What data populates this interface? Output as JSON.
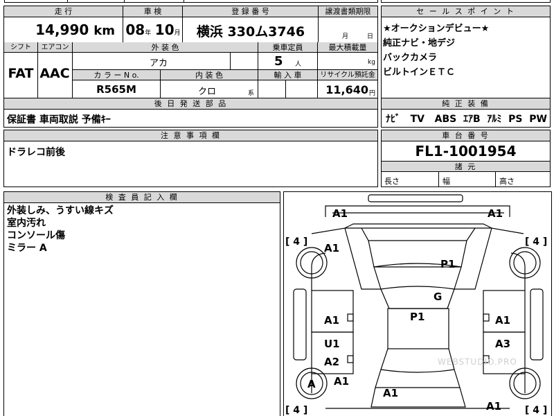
{
  "top_partial": {
    "text": ""
  },
  "main": {
    "mileage": {
      "label": "走 行",
      "value": "14,990",
      "unit": "km"
    },
    "inspection": {
      "label": "車 検",
      "year": "08",
      "year_unit": "年",
      "month": "10",
      "month_unit": "月"
    },
    "registration": {
      "label": "登 録 番 号",
      "value": "横浜 330ム3746"
    },
    "transfer_deadline": {
      "label": "譲渡書類期限",
      "month_unit": "月",
      "day_unit": "日"
    },
    "shift": {
      "label": "シフト",
      "value": "FAT"
    },
    "aircon": {
      "label": "エアコン",
      "value": "AAC"
    },
    "exterior_color": {
      "label": "外 装 色",
      "value": "アカ"
    },
    "color_no": {
      "label": "カ ラ ー N o.",
      "value": "R565M"
    },
    "interior_color": {
      "label": "内 装 色",
      "value": "クロ",
      "suffix": "系"
    },
    "capacity": {
      "label": "乗車定員",
      "value": "5",
      "unit": "人"
    },
    "max_load": {
      "label": "最大積載量",
      "unit": "kg"
    },
    "import": {
      "label": "輸 入 車"
    },
    "recycle": {
      "label": "リサイクル預託金",
      "value": "11,640",
      "unit": "円"
    }
  },
  "sales_points": {
    "label": "セ ー ル ス ポ イ ン ト",
    "lines": [
      "★オークションデビュー★",
      "純正ナビ・地デジ",
      "バックカメラ",
      "ビルトインＥＴＣ"
    ]
  },
  "parts": {
    "label": "後 日 発 送 部 品",
    "value": "保証書  車両取説  予備ｷｰ"
  },
  "equipment": {
    "label": "純 正 装 備",
    "items": [
      "ﾅﾋﾞ",
      "TV",
      "ABS",
      "ｴｱB",
      "ｱﾙﾐ",
      "PS",
      "PW"
    ]
  },
  "notes": {
    "label": "注 意 事 項 欄",
    "value": "ドラレコ前後"
  },
  "chassis": {
    "label": "車 台 番 号",
    "value": "FL1-1001954"
  },
  "dimensions": {
    "label": "諸 元",
    "length": "長さ",
    "width": "幅",
    "height": "高さ"
  },
  "inspector": {
    "label": "検 査 員 記 入 欄",
    "lines": [
      "外装しみ、うすい線キズ",
      "室内汚れ",
      "コンソール傷",
      "ミラー A"
    ]
  },
  "diagram": {
    "marks": [
      "A1",
      "A1",
      "A1",
      "P1",
      "G",
      "P1",
      "A1",
      "A1",
      "U1",
      "A3",
      "A2",
      "A1",
      "A",
      "A1",
      "A1"
    ],
    "tires": [
      "[ 4 ]",
      "[ 4 ]",
      "[ 4 ]",
      "[ 4 ]"
    ],
    "watermark": "WEBSTUDIO.PRO"
  }
}
